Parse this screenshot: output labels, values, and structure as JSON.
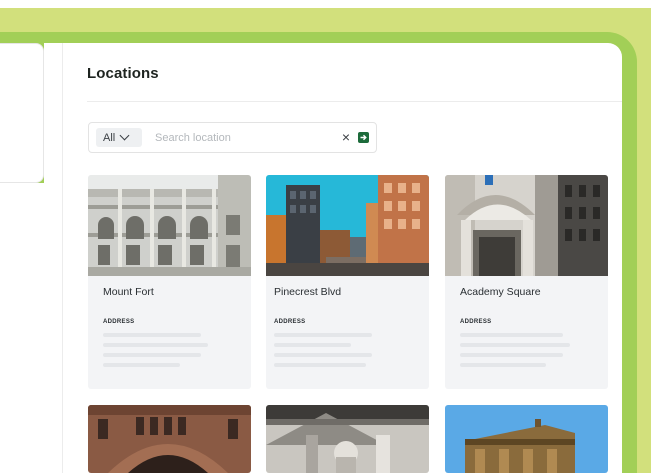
{
  "main": {
    "title": "Locations",
    "search": {
      "filter_value": "All",
      "placeholder": "Search location"
    }
  },
  "locations": [
    {
      "name": "Mount Fort",
      "address_label": "ADDRESS"
    },
    {
      "name": "Pinecrest Blvd",
      "address_label": "ADDRESS"
    },
    {
      "name": "Academy Square",
      "address_label": "ADDRESS"
    }
  ],
  "icons": {
    "filter": "chevron-down-icon",
    "clear": "close-icon",
    "submit": "arrow-right-icon"
  },
  "colors": {
    "backdrop_light": "#d2e07c",
    "backdrop_dark": "#a2cf57",
    "accent": "#1d6b3b",
    "card_bg": "#f3f4f6"
  }
}
